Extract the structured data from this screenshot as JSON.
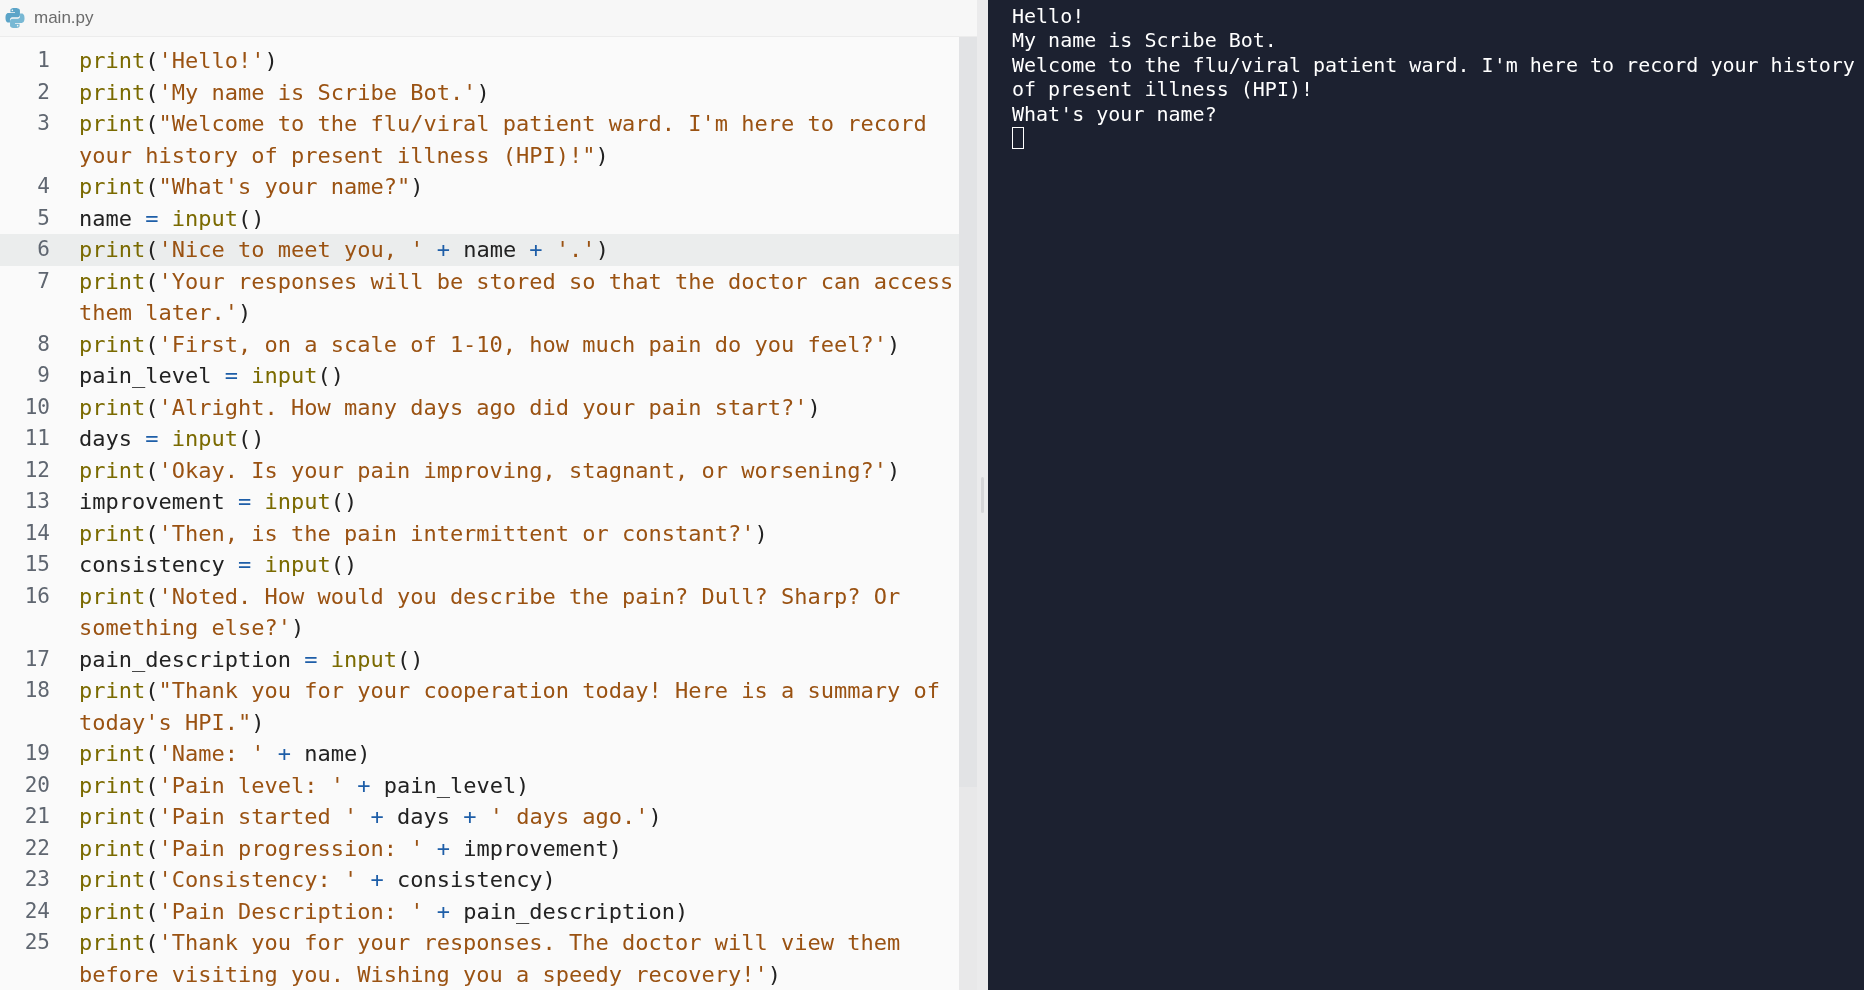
{
  "editor": {
    "tab": {
      "filename": "main.py"
    },
    "lines": [
      {
        "number": "1",
        "highlighted": false,
        "tokens": [
          {
            "kind": "builtin",
            "text": "print"
          },
          {
            "kind": "plain",
            "text": "("
          },
          {
            "kind": "string",
            "text": "'Hello!'"
          },
          {
            "kind": "plain",
            "text": ")"
          }
        ]
      },
      {
        "number": "2",
        "highlighted": false,
        "tokens": [
          {
            "kind": "builtin",
            "text": "print"
          },
          {
            "kind": "plain",
            "text": "("
          },
          {
            "kind": "string",
            "text": "'My name is Scribe Bot.'"
          },
          {
            "kind": "plain",
            "text": ")"
          }
        ]
      },
      {
        "number": "3",
        "highlighted": false,
        "tokens": [
          {
            "kind": "builtin",
            "text": "print"
          },
          {
            "kind": "plain",
            "text": "("
          },
          {
            "kind": "string",
            "text": "\"Welcome to the flu/viral patient ward. I'm here to record your history of present illness (HPI)!\""
          },
          {
            "kind": "plain",
            "text": ")"
          }
        ]
      },
      {
        "number": "4",
        "highlighted": false,
        "tokens": [
          {
            "kind": "builtin",
            "text": "print"
          },
          {
            "kind": "plain",
            "text": "("
          },
          {
            "kind": "string",
            "text": "\"What's your name?\""
          },
          {
            "kind": "plain",
            "text": ")"
          }
        ]
      },
      {
        "number": "5",
        "highlighted": false,
        "tokens": [
          {
            "kind": "plain",
            "text": "name"
          },
          {
            "kind": "operator",
            "text": " = "
          },
          {
            "kind": "builtin",
            "text": "input"
          },
          {
            "kind": "plain",
            "text": "()"
          }
        ]
      },
      {
        "number": "6",
        "highlighted": true,
        "tokens": [
          {
            "kind": "builtin",
            "text": "print"
          },
          {
            "kind": "plain",
            "text": "("
          },
          {
            "kind": "string",
            "text": "'Nice to meet you, '"
          },
          {
            "kind": "operator",
            "text": " + "
          },
          {
            "kind": "plain",
            "text": "name"
          },
          {
            "kind": "operator",
            "text": " + "
          },
          {
            "kind": "string",
            "text": "'.'"
          },
          {
            "kind": "plain",
            "text": ")"
          }
        ]
      },
      {
        "number": "7",
        "highlighted": false,
        "tokens": [
          {
            "kind": "builtin",
            "text": "print"
          },
          {
            "kind": "plain",
            "text": "("
          },
          {
            "kind": "string",
            "text": "'Your responses will be stored so that the doctor can access them later.'"
          },
          {
            "kind": "plain",
            "text": ")"
          }
        ]
      },
      {
        "number": "8",
        "highlighted": false,
        "tokens": [
          {
            "kind": "builtin",
            "text": "print"
          },
          {
            "kind": "plain",
            "text": "("
          },
          {
            "kind": "string",
            "text": "'First, on a scale of 1-10, how much pain do you feel?'"
          },
          {
            "kind": "plain",
            "text": ")"
          }
        ]
      },
      {
        "number": "9",
        "highlighted": false,
        "tokens": [
          {
            "kind": "plain",
            "text": "pain_level"
          },
          {
            "kind": "operator",
            "text": " = "
          },
          {
            "kind": "builtin",
            "text": "input"
          },
          {
            "kind": "plain",
            "text": "()"
          }
        ]
      },
      {
        "number": "10",
        "highlighted": false,
        "tokens": [
          {
            "kind": "builtin",
            "text": "print"
          },
          {
            "kind": "plain",
            "text": "("
          },
          {
            "kind": "string",
            "text": "'Alright. How many days ago did your pain start?'"
          },
          {
            "kind": "plain",
            "text": ")"
          }
        ]
      },
      {
        "number": "11",
        "highlighted": false,
        "tokens": [
          {
            "kind": "plain",
            "text": "days"
          },
          {
            "kind": "operator",
            "text": " = "
          },
          {
            "kind": "builtin",
            "text": "input"
          },
          {
            "kind": "plain",
            "text": "()"
          }
        ]
      },
      {
        "number": "12",
        "highlighted": false,
        "tokens": [
          {
            "kind": "builtin",
            "text": "print"
          },
          {
            "kind": "plain",
            "text": "("
          },
          {
            "kind": "string",
            "text": "'Okay. Is your pain improving, stagnant, or worsening?'"
          },
          {
            "kind": "plain",
            "text": ")"
          }
        ]
      },
      {
        "number": "13",
        "highlighted": false,
        "tokens": [
          {
            "kind": "plain",
            "text": "improvement"
          },
          {
            "kind": "operator",
            "text": " = "
          },
          {
            "kind": "builtin",
            "text": "input"
          },
          {
            "kind": "plain",
            "text": "()"
          }
        ]
      },
      {
        "number": "14",
        "highlighted": false,
        "tokens": [
          {
            "kind": "builtin",
            "text": "print"
          },
          {
            "kind": "plain",
            "text": "("
          },
          {
            "kind": "string",
            "text": "'Then, is the pain intermittent or constant?'"
          },
          {
            "kind": "plain",
            "text": ")"
          }
        ]
      },
      {
        "number": "15",
        "highlighted": false,
        "tokens": [
          {
            "kind": "plain",
            "text": "consistency"
          },
          {
            "kind": "operator",
            "text": " = "
          },
          {
            "kind": "builtin",
            "text": "input"
          },
          {
            "kind": "plain",
            "text": "()"
          }
        ]
      },
      {
        "number": "16",
        "highlighted": false,
        "tokens": [
          {
            "kind": "builtin",
            "text": "print"
          },
          {
            "kind": "plain",
            "text": "("
          },
          {
            "kind": "string",
            "text": "'Noted. How would you describe the pain? Dull? Sharp? Or something else?'"
          },
          {
            "kind": "plain",
            "text": ")"
          }
        ]
      },
      {
        "number": "17",
        "highlighted": false,
        "tokens": [
          {
            "kind": "plain",
            "text": "pain_description"
          },
          {
            "kind": "operator",
            "text": " = "
          },
          {
            "kind": "builtin",
            "text": "input"
          },
          {
            "kind": "plain",
            "text": "()"
          }
        ]
      },
      {
        "number": "18",
        "highlighted": false,
        "tokens": [
          {
            "kind": "builtin",
            "text": "print"
          },
          {
            "kind": "plain",
            "text": "("
          },
          {
            "kind": "string",
            "text": "\"Thank you for your cooperation today! Here is a summary of today's HPI.\""
          },
          {
            "kind": "plain",
            "text": ")"
          }
        ]
      },
      {
        "number": "19",
        "highlighted": false,
        "tokens": [
          {
            "kind": "builtin",
            "text": "print"
          },
          {
            "kind": "plain",
            "text": "("
          },
          {
            "kind": "string",
            "text": "'Name: '"
          },
          {
            "kind": "operator",
            "text": " + "
          },
          {
            "kind": "plain",
            "text": "name)"
          }
        ]
      },
      {
        "number": "20",
        "highlighted": false,
        "tokens": [
          {
            "kind": "builtin",
            "text": "print"
          },
          {
            "kind": "plain",
            "text": "("
          },
          {
            "kind": "string",
            "text": "'Pain level: '"
          },
          {
            "kind": "operator",
            "text": " + "
          },
          {
            "kind": "plain",
            "text": "pain_level)"
          }
        ]
      },
      {
        "number": "21",
        "highlighted": false,
        "tokens": [
          {
            "kind": "builtin",
            "text": "print"
          },
          {
            "kind": "plain",
            "text": "("
          },
          {
            "kind": "string",
            "text": "'Pain started '"
          },
          {
            "kind": "operator",
            "text": " + "
          },
          {
            "kind": "plain",
            "text": "days"
          },
          {
            "kind": "operator",
            "text": " + "
          },
          {
            "kind": "string",
            "text": "' days ago.'"
          },
          {
            "kind": "plain",
            "text": ")"
          }
        ]
      },
      {
        "number": "22",
        "highlighted": false,
        "tokens": [
          {
            "kind": "builtin",
            "text": "print"
          },
          {
            "kind": "plain",
            "text": "("
          },
          {
            "kind": "string",
            "text": "'Pain progression: '"
          },
          {
            "kind": "operator",
            "text": " + "
          },
          {
            "kind": "plain",
            "text": "improvement)"
          }
        ]
      },
      {
        "number": "23",
        "highlighted": false,
        "tokens": [
          {
            "kind": "builtin",
            "text": "print"
          },
          {
            "kind": "plain",
            "text": "("
          },
          {
            "kind": "string",
            "text": "'Consistency: '"
          },
          {
            "kind": "operator",
            "text": " + "
          },
          {
            "kind": "plain",
            "text": "consistency)"
          }
        ]
      },
      {
        "number": "24",
        "highlighted": false,
        "tokens": [
          {
            "kind": "builtin",
            "text": "print"
          },
          {
            "kind": "plain",
            "text": "("
          },
          {
            "kind": "string",
            "text": "'Pain Description: '"
          },
          {
            "kind": "operator",
            "text": " + "
          },
          {
            "kind": "plain",
            "text": "pain_description)"
          }
        ]
      },
      {
        "number": "25",
        "highlighted": false,
        "tokens": [
          {
            "kind": "builtin",
            "text": "print"
          },
          {
            "kind": "plain",
            "text": "("
          },
          {
            "kind": "string",
            "text": "'Thank you for your responses. The doctor will view them before visiting you. Wishing you a speedy recovery!'"
          },
          {
            "kind": "plain",
            "text": ")"
          }
        ]
      }
    ]
  },
  "console": {
    "output": [
      "Hello!",
      "My name is Scribe Bot.",
      "Welcome to the flu/viral patient ward. I'm here to record your history of present illness (HPI)!",
      "What's your name?"
    ]
  }
}
